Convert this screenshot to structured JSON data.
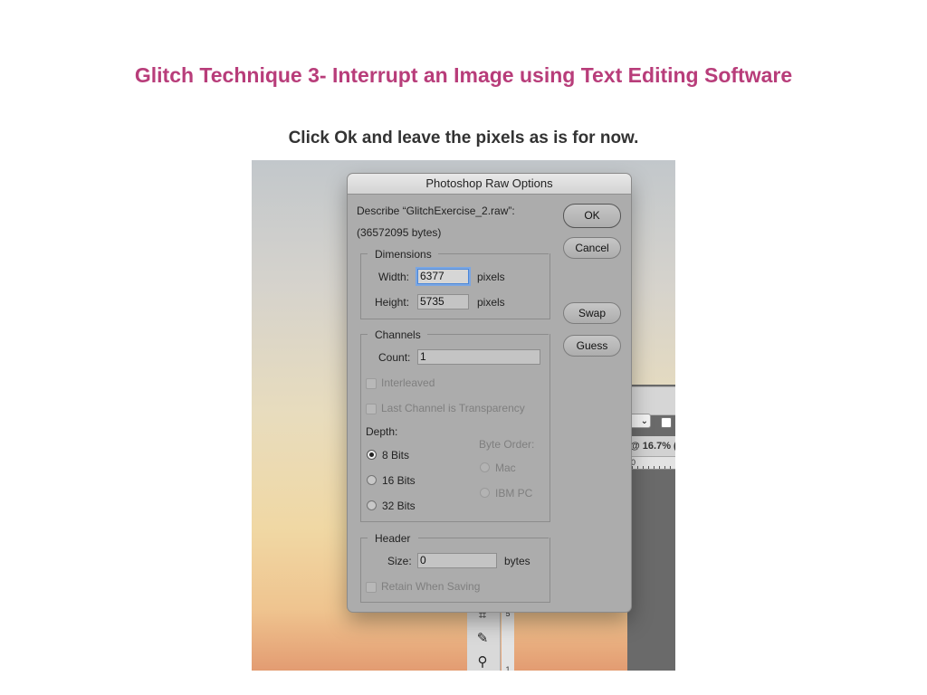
{
  "slide": {
    "title": "Glitch Technique 3- Interrupt an Image using Text Editing Software",
    "subtitle": "Click Ok and leave the pixels as is for now."
  },
  "background_app": {
    "zoom_text": "@ 16.7% (",
    "ruler_start": "0",
    "vruler_labels": [
      "5",
      "1"
    ]
  },
  "dialog": {
    "title": "Photoshop Raw Options",
    "describe_label": "Describe “GlitchExercise_2.raw”:",
    "file_size": "(36572095 bytes)",
    "dimensions": {
      "title": "Dimensions",
      "width_label": "Width:",
      "width_value": "6377",
      "width_unit": "pixels",
      "height_label": "Height:",
      "height_value": "5735",
      "height_unit": "pixels"
    },
    "channels": {
      "title": "Channels",
      "count_label": "Count:",
      "count_value": "1",
      "interleaved_label": "Interleaved",
      "transparency_label": "Last Channel is Transparency",
      "depth_label": "Depth:",
      "depth_options": [
        "8 Bits",
        "16 Bits",
        "32 Bits"
      ],
      "depth_selected": "8 Bits",
      "byte_order_label": "Byte Order:",
      "byte_order_options": [
        "Mac",
        "IBM PC"
      ]
    },
    "header": {
      "title": "Header",
      "size_label": "Size:",
      "size_value": "0",
      "size_unit": "bytes",
      "retain_label": "Retain When Saving"
    },
    "buttons": {
      "ok": "OK",
      "cancel": "Cancel",
      "swap": "Swap",
      "guess": "Guess"
    }
  },
  "colors": {
    "title_accent": "#b83d7a",
    "dialog_bg": "#acacac",
    "focus_ring": "#4a86d8"
  }
}
